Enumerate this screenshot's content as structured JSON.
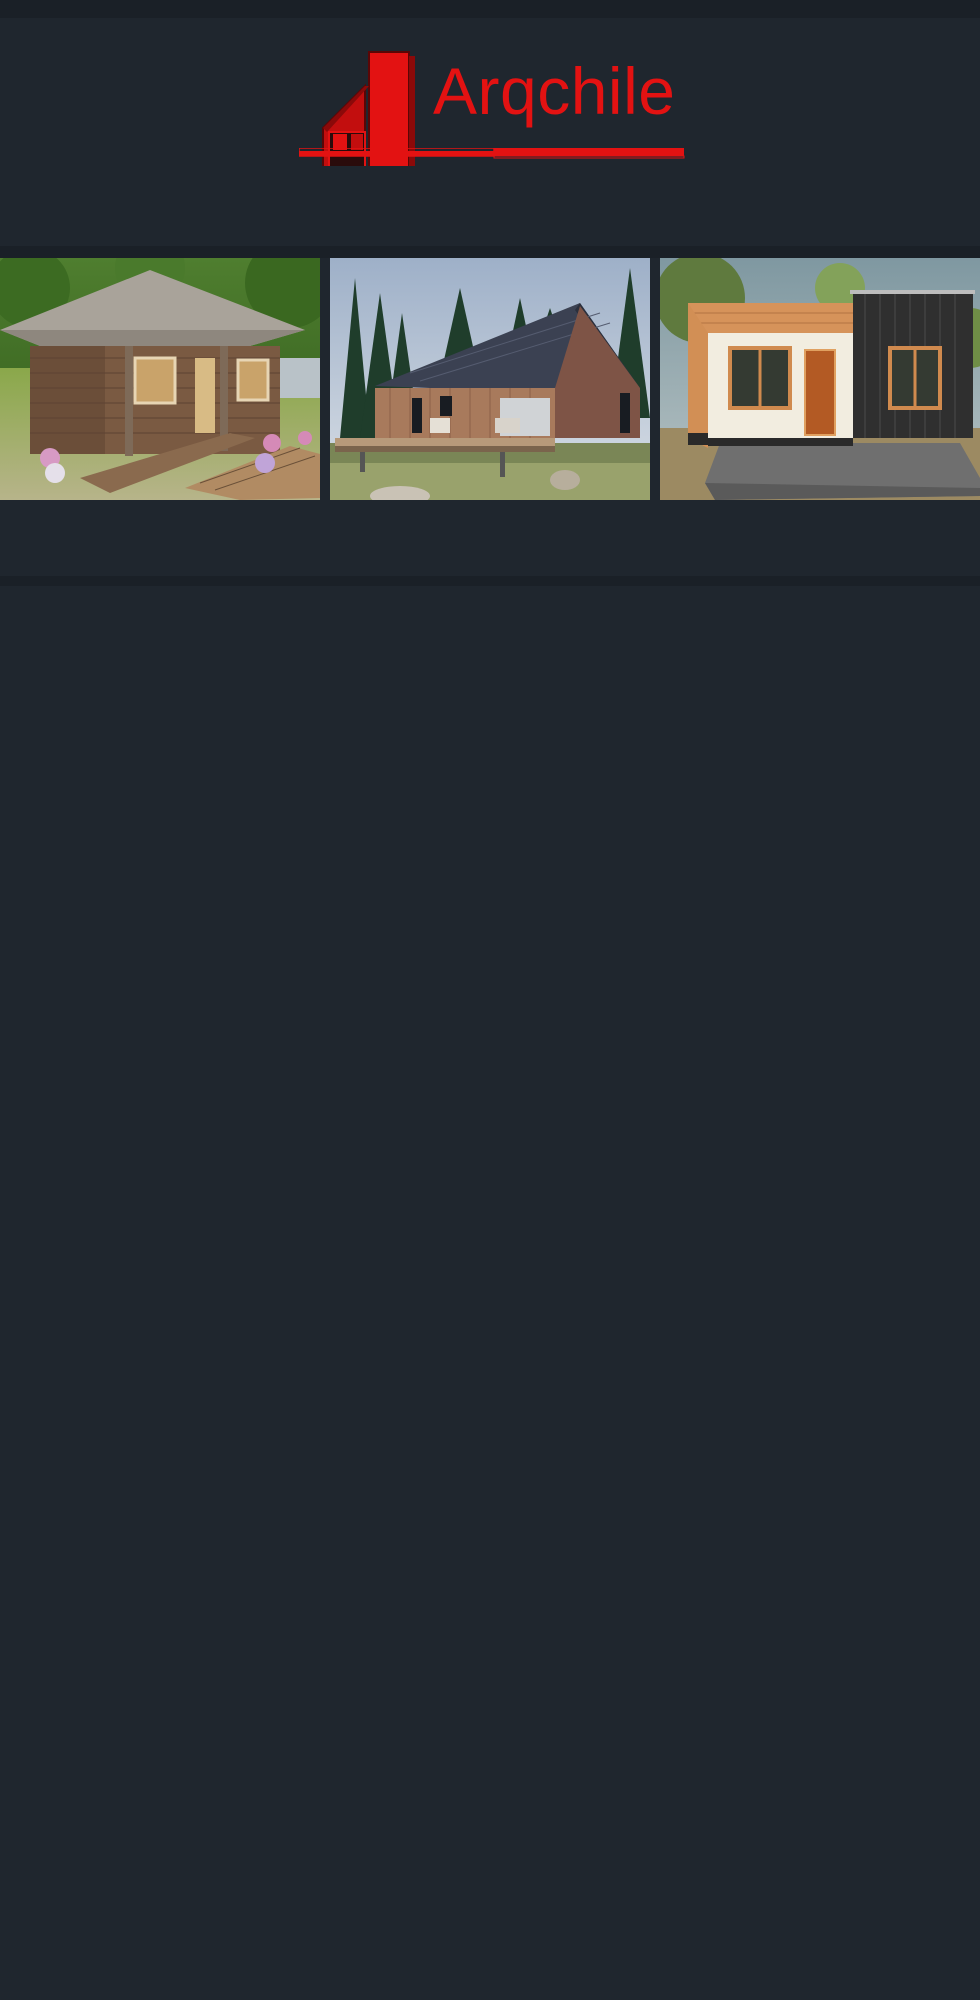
{
  "brand": {
    "name": "Arqchile",
    "color": "#e31212"
  },
  "gallery": {
    "images": [
      {
        "name": "wooden-cabin-hip-roof"
      },
      {
        "name": "modern-gable-house-forest"
      },
      {
        "name": "small-modern-house-black-wood"
      }
    ]
  },
  "colors": {
    "background": "#1f262e",
    "band": "#1a2027"
  }
}
